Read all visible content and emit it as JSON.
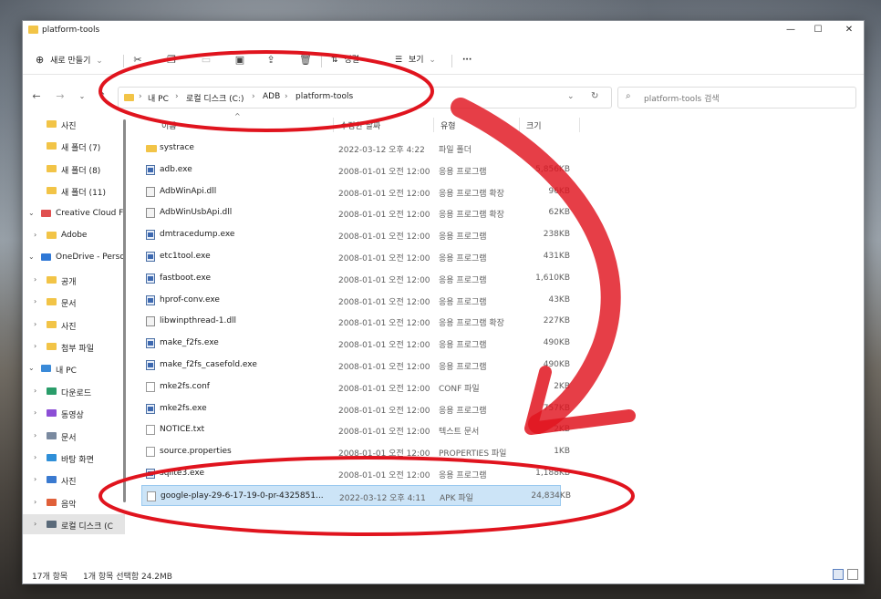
{
  "window": {
    "title": "platform-tools",
    "controls": {
      "minimize": "—",
      "maximize": "☐",
      "close": "✕"
    }
  },
  "toolbar": {
    "new_label": "새로 만들기",
    "new_icon": "plus-circle-icon",
    "icons": [
      "cut-icon",
      "copy-icon",
      "paste-icon",
      "rename-icon",
      "share-icon",
      "delete-icon"
    ],
    "sort_label": "정렬",
    "view_label": "보기",
    "more": "···"
  },
  "address": {
    "breadcrumbs": [
      "내 PC",
      "로컬 디스크 (C:)",
      "ADB",
      "platform-tools"
    ],
    "search_placeholder": "platform-tools 검색"
  },
  "sidebar": {
    "items": [
      {
        "label": "사진",
        "icon": "folder-icon",
        "color": "#f2c447",
        "chevron": ""
      },
      {
        "label": "새 폴더 (7)",
        "icon": "folder-icon",
        "color": "#f2c447",
        "chevron": ""
      },
      {
        "label": "새 폴더 (8)",
        "icon": "folder-icon",
        "color": "#f2c447",
        "chevron": ""
      },
      {
        "label": "새 폴더 (11)",
        "icon": "folder-icon",
        "color": "#f2c447",
        "chevron": ""
      },
      {
        "label": "Creative Cloud F",
        "icon": "creative-cloud-icon",
        "color": "#e05050",
        "chevron": "⌄"
      },
      {
        "label": "Adobe",
        "icon": "folder-icon",
        "color": "#f2c447",
        "chevron": "›"
      },
      {
        "label": "OneDrive - Perso",
        "icon": "onedrive-icon",
        "color": "#2f78d6",
        "chevron": "⌄"
      },
      {
        "label": "공개",
        "icon": "folder-icon",
        "color": "#f2c447",
        "chevron": "›"
      },
      {
        "label": "문서",
        "icon": "folder-icon",
        "color": "#f2c447",
        "chevron": "›"
      },
      {
        "label": "사진",
        "icon": "folder-icon",
        "color": "#f2c447",
        "chevron": "›"
      },
      {
        "label": "첨부 파일",
        "icon": "folder-icon",
        "color": "#f2c447",
        "chevron": "›"
      },
      {
        "label": "내 PC",
        "icon": "pc-icon",
        "color": "#3a8ad8",
        "chevron": "⌄"
      },
      {
        "label": "다운로드",
        "icon": "download-icon",
        "color": "#2a9d6a",
        "chevron": "›"
      },
      {
        "label": "동영상",
        "icon": "video-icon",
        "color": "#8c4fd6",
        "chevron": "›"
      },
      {
        "label": "문서",
        "icon": "document-icon",
        "color": "#7a8aa0",
        "chevron": "›"
      },
      {
        "label": "바탕 화면",
        "icon": "desktop-icon",
        "color": "#2f8fd8",
        "chevron": "›"
      },
      {
        "label": "사진",
        "icon": "pictures-icon",
        "color": "#3a7ad0",
        "chevron": "›"
      },
      {
        "label": "음악",
        "icon": "music-icon",
        "color": "#e0603a",
        "chevron": "›"
      },
      {
        "label": "로컬 디스크 (C",
        "icon": "drive-icon",
        "color": "#5a6a7a",
        "chevron": "›"
      }
    ]
  },
  "columns": {
    "name": "이름",
    "date": "수정한 날짜",
    "type": "유형",
    "size": "크기"
  },
  "files": [
    {
      "name": "systrace",
      "date": "2022-03-12 오후 4:22",
      "type": "파일 폴더",
      "size": "",
      "kind": "folder"
    },
    {
      "name": "adb.exe",
      "date": "2008-01-01 오전 12:00",
      "type": "응용 프로그램",
      "size": "5,856KB",
      "kind": "exe"
    },
    {
      "name": "AdbWinApi.dll",
      "date": "2008-01-01 오전 12:00",
      "type": "응용 프로그램 확장",
      "size": "96KB",
      "kind": "dll"
    },
    {
      "name": "AdbWinUsbApi.dll",
      "date": "2008-01-01 오전 12:00",
      "type": "응용 프로그램 확장",
      "size": "62KB",
      "kind": "dll"
    },
    {
      "name": "dmtracedump.exe",
      "date": "2008-01-01 오전 12:00",
      "type": "응용 프로그램",
      "size": "238KB",
      "kind": "exe"
    },
    {
      "name": "etc1tool.exe",
      "date": "2008-01-01 오전 12:00",
      "type": "응용 프로그램",
      "size": "431KB",
      "kind": "exe"
    },
    {
      "name": "fastboot.exe",
      "date": "2008-01-01 오전 12:00",
      "type": "응용 프로그램",
      "size": "1,610KB",
      "kind": "exe"
    },
    {
      "name": "hprof-conv.exe",
      "date": "2008-01-01 오전 12:00",
      "type": "응용 프로그램",
      "size": "43KB",
      "kind": "exe"
    },
    {
      "name": "libwinpthread-1.dll",
      "date": "2008-01-01 오전 12:00",
      "type": "응용 프로그램 확장",
      "size": "227KB",
      "kind": "dll"
    },
    {
      "name": "make_f2fs.exe",
      "date": "2008-01-01 오전 12:00",
      "type": "응용 프로그램",
      "size": "490KB",
      "kind": "exe"
    },
    {
      "name": "make_f2fs_casefold.exe",
      "date": "2008-01-01 오전 12:00",
      "type": "응용 프로그램",
      "size": "490KB",
      "kind": "exe"
    },
    {
      "name": "mke2fs.conf",
      "date": "2008-01-01 오전 12:00",
      "type": "CONF 파일",
      "size": "2KB",
      "kind": "file"
    },
    {
      "name": "mke2fs.exe",
      "date": "2008-01-01 오전 12:00",
      "type": "응용 프로그램",
      "size": "757KB",
      "kind": "exe"
    },
    {
      "name": "NOTICE.txt",
      "date": "2008-01-01 오전 12:00",
      "type": "텍스트 문서",
      "size": "2KB",
      "kind": "file"
    },
    {
      "name": "source.properties",
      "date": "2008-01-01 오전 12:00",
      "type": "PROPERTIES 파일",
      "size": "1KB",
      "kind": "file"
    },
    {
      "name": "sqlite3.exe",
      "date": "2008-01-01 오전 12:00",
      "type": "응용 프로그램",
      "size": "1,188KB",
      "kind": "exe"
    },
    {
      "name": "google-play-29-6-17-19-0-pr-4325851...",
      "date": "2022-03-12 오후 4:11",
      "type": "APK 파일",
      "size": "24,834KB",
      "kind": "file",
      "selected": true
    }
  ],
  "status": {
    "count": "17개 항목",
    "selection": "1개 항목 선택함 24.2MB"
  },
  "colors": {
    "annotation": "#e0141e",
    "selection": "#cce4f7",
    "folder": "#f2c447"
  }
}
